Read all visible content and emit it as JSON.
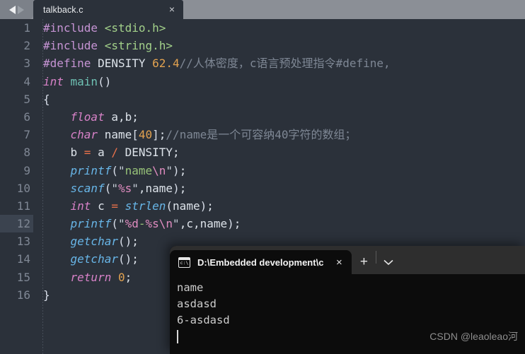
{
  "tabbar": {
    "nav_back_icon": "arrow-left-icon",
    "nav_forward_icon": "arrow-right-icon",
    "file_tab_label": "talkback.c",
    "close_label": "×"
  },
  "editor": {
    "theme_bg": "#2b313a",
    "active_line": 12,
    "lines": [
      {
        "n": "1",
        "tokens": [
          {
            "t": "#include ",
            "c": "c-pp"
          },
          {
            "t": "<stdio.h>",
            "c": "c-hdr"
          }
        ]
      },
      {
        "n": "2",
        "tokens": [
          {
            "t": "#include ",
            "c": "c-pp"
          },
          {
            "t": "<string.h>",
            "c": "c-hdr"
          }
        ]
      },
      {
        "n": "3",
        "tokens": [
          {
            "t": "#define ",
            "c": "c-pp"
          },
          {
            "t": "DENSITY ",
            "c": "c-def"
          },
          {
            "t": "62.4",
            "c": "c-numo"
          },
          {
            "t": "//人体密度，c语言预处理指令#define,",
            "c": "c-com"
          }
        ]
      },
      {
        "n": "4",
        "tokens": [
          {
            "t": "int ",
            "c": "c-kw"
          },
          {
            "t": "main",
            "c": "c-fnm"
          },
          {
            "t": "()",
            "c": "c-brk"
          }
        ]
      },
      {
        "n": "5",
        "tokens": [
          {
            "t": "{",
            "c": "c-brk"
          }
        ]
      },
      {
        "n": "6",
        "tokens": [
          {
            "t": "    ",
            "c": "c-def"
          },
          {
            "t": "float ",
            "c": "c-kw"
          },
          {
            "t": "a,b;",
            "c": "c-def"
          }
        ]
      },
      {
        "n": "7",
        "tokens": [
          {
            "t": "    ",
            "c": "c-def"
          },
          {
            "t": "char ",
            "c": "c-kw"
          },
          {
            "t": "name",
            "c": "c-def"
          },
          {
            "t": "[",
            "c": "c-brk"
          },
          {
            "t": "40",
            "c": "c-numo"
          },
          {
            "t": "]",
            "c": "c-brk"
          },
          {
            "t": ";",
            "c": "c-def"
          },
          {
            "t": "//name是一个可容纳40字符的数组；",
            "c": "c-com"
          }
        ]
      },
      {
        "n": "8",
        "tokens": [
          {
            "t": "    b ",
            "c": "c-def"
          },
          {
            "t": "=",
            "c": "c-op"
          },
          {
            "t": " a ",
            "c": "c-def"
          },
          {
            "t": "/",
            "c": "c-op"
          },
          {
            "t": " DENSITY;",
            "c": "c-def"
          }
        ]
      },
      {
        "n": "9",
        "tokens": [
          {
            "t": "    ",
            "c": "c-def"
          },
          {
            "t": "printf",
            "c": "c-fn"
          },
          {
            "t": "(",
            "c": "c-brk"
          },
          {
            "t": "\"",
            "c": "c-quote"
          },
          {
            "t": "name",
            "c": "c-str"
          },
          {
            "t": "\\n",
            "c": "c-esc"
          },
          {
            "t": "\"",
            "c": "c-quote"
          },
          {
            "t": ")",
            "c": "c-brk"
          },
          {
            "t": ";",
            "c": "c-def"
          }
        ]
      },
      {
        "n": "10",
        "tokens": [
          {
            "t": "    ",
            "c": "c-def"
          },
          {
            "t": "scanf",
            "c": "c-fn"
          },
          {
            "t": "(",
            "c": "c-brk"
          },
          {
            "t": "\"",
            "c": "c-quote"
          },
          {
            "t": "%s",
            "c": "c-esc"
          },
          {
            "t": "\"",
            "c": "c-quote"
          },
          {
            "t": ",name",
            "c": "c-def"
          },
          {
            "t": ")",
            "c": "c-brk"
          },
          {
            "t": ";",
            "c": "c-def"
          }
        ]
      },
      {
        "n": "11",
        "tokens": [
          {
            "t": "    ",
            "c": "c-def"
          },
          {
            "t": "int ",
            "c": "c-kw"
          },
          {
            "t": "c ",
            "c": "c-def"
          },
          {
            "t": "=",
            "c": "c-op"
          },
          {
            "t": " ",
            "c": "c-def"
          },
          {
            "t": "strlen",
            "c": "c-fn"
          },
          {
            "t": "(",
            "c": "c-brk"
          },
          {
            "t": "name",
            "c": "c-def"
          },
          {
            "t": ")",
            "c": "c-brk"
          },
          {
            "t": ";",
            "c": "c-def"
          }
        ]
      },
      {
        "n": "12",
        "tokens": [
          {
            "t": "    ",
            "c": "c-def"
          },
          {
            "t": "printf",
            "c": "c-fn"
          },
          {
            "t": "(",
            "c": "c-brk"
          },
          {
            "t": "\"",
            "c": "c-quote"
          },
          {
            "t": "%d",
            "c": "c-esc"
          },
          {
            "t": "-",
            "c": "c-str"
          },
          {
            "t": "%s",
            "c": "c-esc"
          },
          {
            "t": "\\n",
            "c": "c-esc"
          },
          {
            "t": "\"",
            "c": "c-quote"
          },
          {
            "t": ",c,name",
            "c": "c-def"
          },
          {
            "t": ")",
            "c": "c-brk"
          },
          {
            "t": ";",
            "c": "c-def"
          }
        ]
      },
      {
        "n": "13",
        "tokens": [
          {
            "t": "    ",
            "c": "c-def"
          },
          {
            "t": "getchar",
            "c": "c-fn"
          },
          {
            "t": "()",
            "c": "c-brk"
          },
          {
            "t": ";",
            "c": "c-def"
          }
        ]
      },
      {
        "n": "14",
        "tokens": [
          {
            "t": "    ",
            "c": "c-def"
          },
          {
            "t": "getchar",
            "c": "c-fn"
          },
          {
            "t": "()",
            "c": "c-brk"
          },
          {
            "t": ";",
            "c": "c-def"
          }
        ]
      },
      {
        "n": "15",
        "tokens": [
          {
            "t": "    ",
            "c": "c-def"
          },
          {
            "t": "return ",
            "c": "c-kw"
          },
          {
            "t": "0",
            "c": "c-numo"
          },
          {
            "t": ";",
            "c": "c-def"
          }
        ]
      },
      {
        "n": "16",
        "tokens": [
          {
            "t": "}",
            "c": "c-brk"
          }
        ]
      }
    ]
  },
  "terminal": {
    "icon_name": "console-icon",
    "icon_text": "c:\\",
    "tab_title": "D:\\Embedded development\\c",
    "close_label": "×",
    "newtab_label": "+",
    "chevron_label": "⌄",
    "output_lines": [
      "name",
      "asdasd",
      "6-asdasd"
    ]
  },
  "watermark": {
    "text": "CSDN @leaoleao河"
  }
}
